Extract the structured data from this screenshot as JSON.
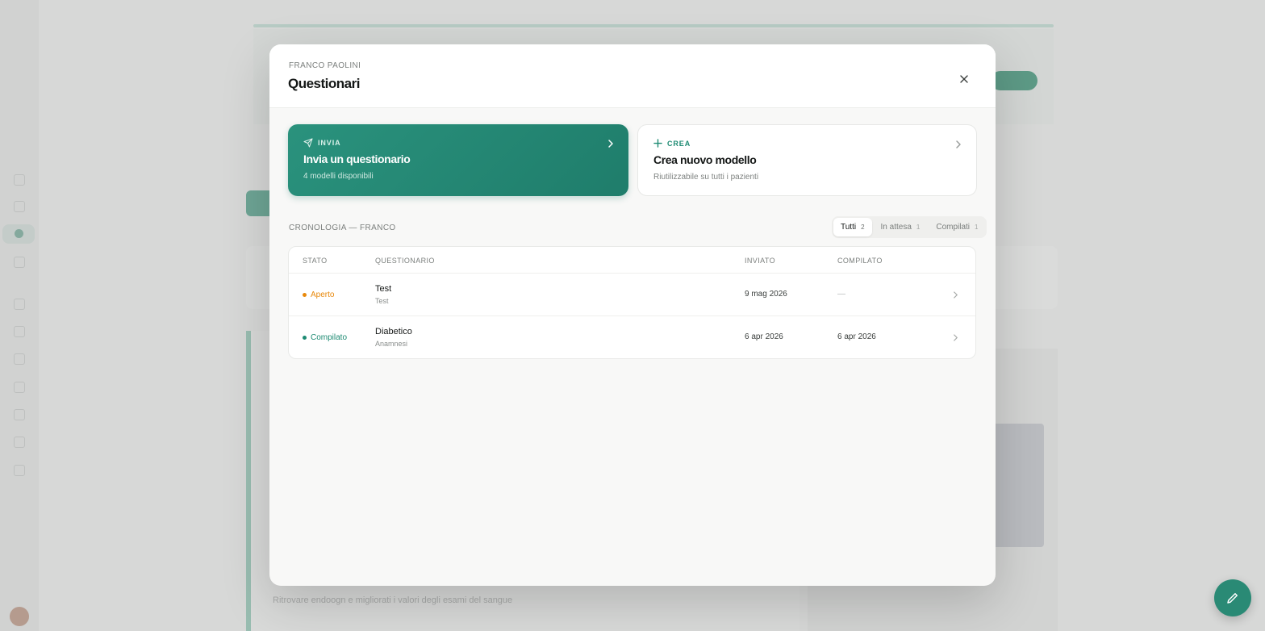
{
  "modal": {
    "patient_name": "FRANCO PAOLINI",
    "title": "Questionari"
  },
  "cards": {
    "send": {
      "kicker": "INVIA",
      "title": "Invia un questionario",
      "subtitle": "4 modelli disponibili"
    },
    "create": {
      "kicker": "CREA",
      "title": "Crea nuovo modello",
      "subtitle": "Riutilizzabile su tutti i pazienti"
    }
  },
  "history": {
    "label": "CRONOLOGIA — FRANCO",
    "filters": [
      {
        "label": "Tutti",
        "count": "2",
        "active": true
      },
      {
        "label": "In attesa",
        "count": "1",
        "active": false
      },
      {
        "label": "Compilati",
        "count": "1",
        "active": false
      }
    ],
    "columns": {
      "status": "STATO",
      "questionnaire": "QUESTIONARIO",
      "sent": "INVIATO",
      "completed": "COMPILATO"
    },
    "rows": [
      {
        "status": "Aperto",
        "status_color": "#e8890c",
        "name": "Test",
        "category": "Test",
        "sent": "9 mag 2026",
        "completed": "—"
      },
      {
        "status": "Compilato",
        "status_color": "#1e8b73",
        "name": "Diabetico",
        "category": "Anamnesi",
        "sent": "6 apr 2026",
        "completed": "6 apr 2026"
      }
    ]
  },
  "background": {
    "footer_text": "Ritrovare endoogn e migliorati i valori degli esami del sangue"
  },
  "colors": {
    "accent": "#1e8b73",
    "accent_light": "#2a927d",
    "pending": "#e8890c"
  },
  "icons": {
    "close": "close-icon",
    "send": "paper-plane-icon",
    "create": "plus-icon",
    "chevron": "chevron-right-icon",
    "fab": "pencil-icon"
  }
}
